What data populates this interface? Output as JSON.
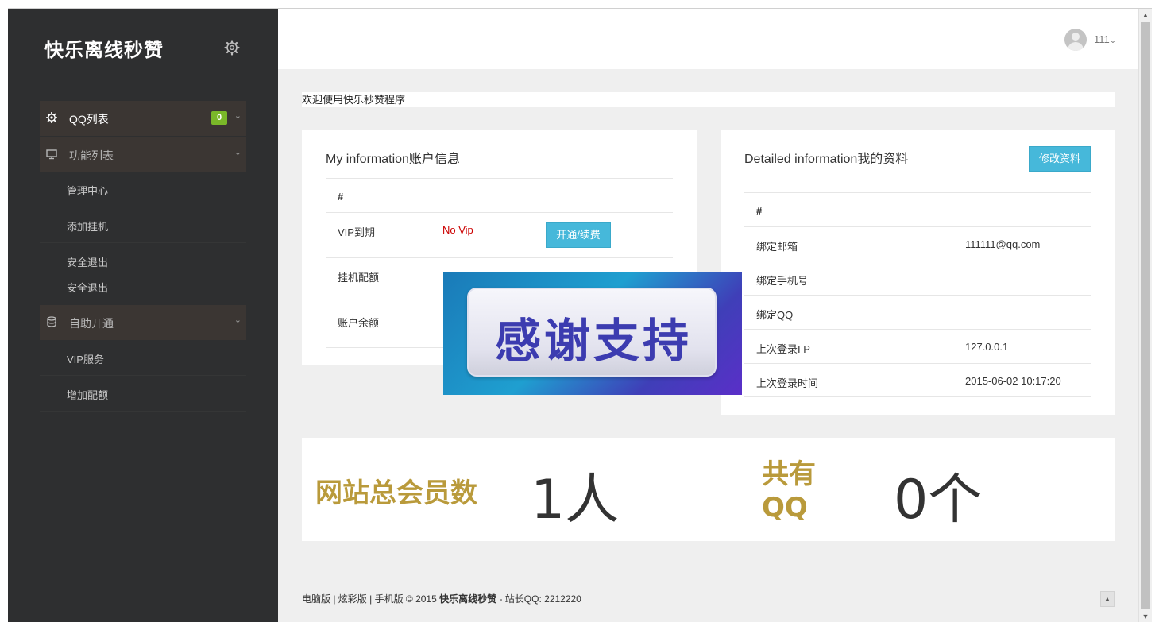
{
  "sidebar": {
    "brand": "快乐离线秒赞",
    "groups": [
      {
        "label": "QQ列表",
        "badge": "0"
      },
      {
        "label": "功能列表"
      },
      {
        "label": "自助开通"
      }
    ],
    "items": [
      "管理中心",
      "添加挂机",
      "安全退出",
      "安全退出",
      "VIP服务",
      "增加配额"
    ]
  },
  "header": {
    "username": "111"
  },
  "welcome": "欢迎使用快乐秒赞程序",
  "account_panel": {
    "title": "My information账户信息",
    "hash": "#",
    "rows": [
      {
        "label": "VIP到期",
        "value": "No Vip",
        "button": "开通/续费"
      },
      {
        "label": "挂机配额"
      },
      {
        "label": "账户余额"
      }
    ]
  },
  "profile_panel": {
    "title": "Detailed information我的资料",
    "edit_button": "修改资料",
    "hash": "#",
    "rows": [
      {
        "label": "绑定邮箱",
        "value": "111111@qq.com"
      },
      {
        "label": "绑定手机号",
        "value": ""
      },
      {
        "label": "绑定QQ",
        "value": ""
      },
      {
        "label": "上次登录I P",
        "value": "127.0.0.1"
      },
      {
        "label": "上次登录时间",
        "value": "2015-06-02 10:17:20"
      }
    ]
  },
  "promo": {
    "text": "感谢支持"
  },
  "stats": {
    "members_label": "网站总会员数",
    "members_value": "1人",
    "qq_label_a": "共有",
    "qq_label_b": "QQ",
    "qq_value": "0个"
  },
  "footer": {
    "links": "电脑版 | 炫彩版 | 手机版 © 2015 ",
    "site": "快乐离线秒赞",
    "contact": " - 站长QQ: 2212220"
  },
  "colors": {
    "sidebar_bg": "#2e2f30",
    "accent_button": "#46b8da",
    "vip_red": "#cc0000",
    "badge_green": "#7ab829",
    "stat_gold": "#b99a3b"
  }
}
